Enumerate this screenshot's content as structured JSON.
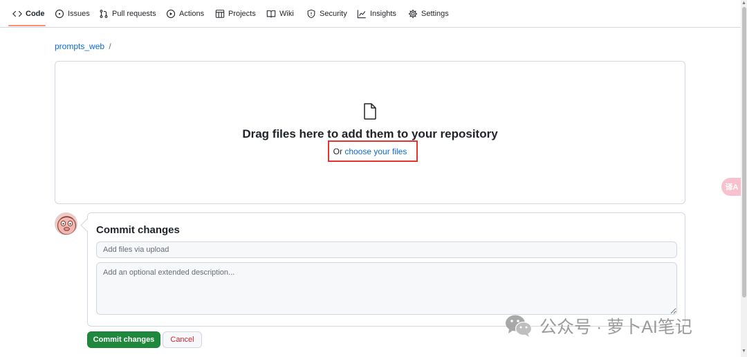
{
  "nav": {
    "items": [
      {
        "label": "Code",
        "icon": "code-icon"
      },
      {
        "label": "Issues",
        "icon": "issue-icon"
      },
      {
        "label": "Pull requests",
        "icon": "pull-request-icon"
      },
      {
        "label": "Actions",
        "icon": "play-icon"
      },
      {
        "label": "Projects",
        "icon": "table-icon"
      },
      {
        "label": "Wiki",
        "icon": "book-icon"
      },
      {
        "label": "Security",
        "icon": "shield-icon"
      },
      {
        "label": "Insights",
        "icon": "graph-icon"
      },
      {
        "label": "Settings",
        "icon": "gear-icon"
      }
    ],
    "active": "Code",
    "accent": "#fd8c73"
  },
  "breadcrumb": {
    "repo": "prompts_web",
    "separator": "/"
  },
  "dropzone": {
    "title": "Drag files here to add them to your repository",
    "prefix": "Or",
    "link": "choose your files",
    "highlight_color": "#e5322d"
  },
  "commit": {
    "title": "Commit changes",
    "summary_placeholder": "Add files via upload",
    "description_placeholder": "Add an optional extended description...",
    "commit_button": "Commit changes",
    "cancel_button": "Cancel",
    "commit_color": "#1f883d",
    "cancel_color": "#cf222e"
  },
  "translate": {
    "label": "译A"
  },
  "watermark": {
    "text": "公众号 · 萝卜AI笔记"
  }
}
